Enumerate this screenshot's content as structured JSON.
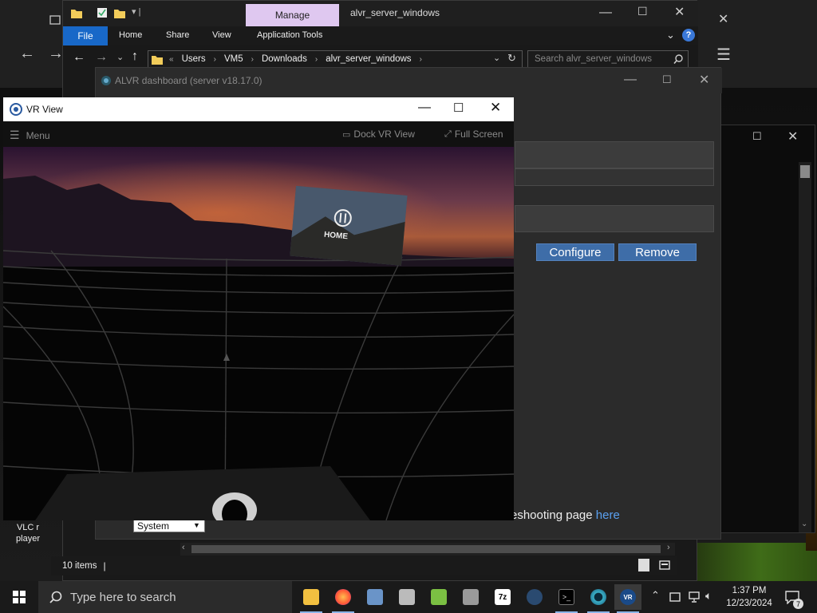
{
  "explorer": {
    "title": "alvr_server_windows",
    "context_tab": "Manage",
    "ribbon_tabs": [
      "File",
      "Home",
      "Share",
      "View",
      "Application Tools"
    ],
    "breadcrumb": [
      "Users",
      "VM5",
      "Downloads",
      "alvr_server_windows"
    ],
    "search_placeholder": "Search alvr_server_windows",
    "status_items": "10 items",
    "colors": {
      "file_tab": "#1868c8",
      "manage_tab": "#dfc8f0",
      "help": "#3a78d8"
    }
  },
  "alvr": {
    "title": "ALVR dashboard (server v18.17.0)",
    "configure_label": "Configure",
    "remove_label": "Remove",
    "troubleshoot_text": "eshooting page",
    "troubleshoot_link": "here",
    "language_select": "System",
    "colors": {
      "button": "#3e6da8",
      "link": "#5aa0f0"
    }
  },
  "vr_view": {
    "title": "VR View",
    "menu_label": "Menu",
    "dock_label": "Dock VR View",
    "fullscreen_label": "Full Screen",
    "home_label": "HOME"
  },
  "desktop": {
    "vlc_label_1": "VLC r",
    "vlc_label_2": "player"
  },
  "taskbar": {
    "search_placeholder": "Type here to search",
    "time": "1:37 PM",
    "date": "12/23/2024",
    "notifications": "7",
    "apps": [
      "file-explorer",
      "firefox",
      "control-panel",
      "sandbox",
      "notepad",
      "printer-app",
      "7zip",
      "steam",
      "terminal",
      "alvr",
      "steamvr"
    ]
  }
}
